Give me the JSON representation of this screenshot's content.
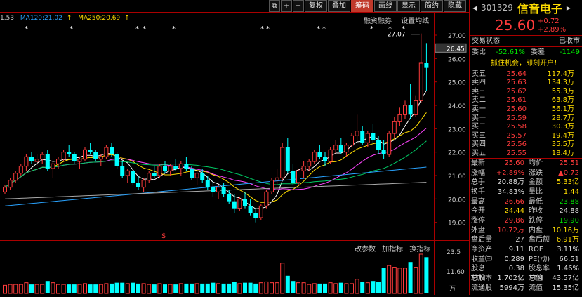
{
  "toolbar": {
    "buttons": [
      "复权",
      "叠加",
      "筹码",
      "画线",
      "显示",
      "简约",
      "隐藏"
    ],
    "active": "筹码"
  },
  "ma_legend": {
    "prefix": "1.53",
    "ma120": "MA120:21.02",
    "ma250": "MA250:20.69"
  },
  "chart_links": {
    "a": "融资融券",
    "b": "设置均线"
  },
  "volume_links": {
    "a": "改参数",
    "b": "加指标",
    "c": "换指标"
  },
  "chart_data": {
    "type": "candlestick",
    "price_axis_labels": [
      "27.00",
      "26.00",
      "25.00",
      "24.00",
      "23.00",
      "22.00",
      "21.00",
      "20.00",
      "19.00"
    ],
    "current_price_tag": "26.45",
    "high_annotation": "27.07",
    "volume_axis_labels": [
      "23.5",
      "11.60"
    ],
    "volume_unit": "万",
    "event_marker": "$",
    "ylim": [
      18.6,
      27.3
    ],
    "candles": [
      [
        20.3,
        20.6,
        20.2,
        20.5
      ],
      [
        20.5,
        20.9,
        20.4,
        20.8
      ],
      [
        20.8,
        21.2,
        20.7,
        21.1
      ],
      [
        21.1,
        21.5,
        21.0,
        21.4
      ],
      [
        21.4,
        21.9,
        21.2,
        21.8
      ],
      [
        21.8,
        22.0,
        21.5,
        21.6
      ],
      [
        21.6,
        21.9,
        21.4,
        21.7
      ],
      [
        21.7,
        22.0,
        21.5,
        21.9
      ],
      [
        21.9,
        22.1,
        21.2,
        21.3
      ],
      [
        21.3,
        21.6,
        20.9,
        21.5
      ],
      [
        21.5,
        21.8,
        21.3,
        21.7
      ],
      [
        21.7,
        22.1,
        21.6,
        22.0
      ],
      [
        22.0,
        22.3,
        21.8,
        21.9
      ],
      [
        21.9,
        22.0,
        21.5,
        21.6
      ],
      [
        21.6,
        21.8,
        21.3,
        21.7
      ],
      [
        21.7,
        22.2,
        21.6,
        22.1
      ],
      [
        22.1,
        22.4,
        21.9,
        22.0
      ],
      [
        22.0,
        22.1,
        21.6,
        21.7
      ],
      [
        21.7,
        21.9,
        21.4,
        21.8
      ],
      [
        21.8,
        22.3,
        21.7,
        22.2
      ],
      [
        22.2,
        22.4,
        21.8,
        21.9
      ],
      [
        21.9,
        22.0,
        21.3,
        21.4
      ],
      [
        21.4,
        21.6,
        20.9,
        21.0
      ],
      [
        21.0,
        21.3,
        20.7,
        21.2
      ],
      [
        21.2,
        21.3,
        20.6,
        20.7
      ],
      [
        20.7,
        21.0,
        20.4,
        20.5
      ],
      [
        20.5,
        20.9,
        20.3,
        20.8
      ],
      [
        20.8,
        21.2,
        20.7,
        21.1
      ],
      [
        21.1,
        21.4,
        20.9,
        21.0
      ],
      [
        21.0,
        21.5,
        20.9,
        21.4
      ],
      [
        21.4,
        21.6,
        21.1,
        21.2
      ],
      [
        21.2,
        21.5,
        21.0,
        21.4
      ],
      [
        21.4,
        21.7,
        21.2,
        21.3
      ],
      [
        21.3,
        21.6,
        21.0,
        21.5
      ],
      [
        21.5,
        21.8,
        21.2,
        21.3
      ],
      [
        21.3,
        21.4,
        20.8,
        20.9
      ],
      [
        20.9,
        21.2,
        20.6,
        21.1
      ],
      [
        21.1,
        21.3,
        20.7,
        20.8
      ],
      [
        20.8,
        21.0,
        20.4,
        20.5
      ],
      [
        20.5,
        20.8,
        20.1,
        20.3
      ],
      [
        20.3,
        20.6,
        20.0,
        20.5
      ],
      [
        20.5,
        20.7,
        20.1,
        20.2
      ],
      [
        20.2,
        20.4,
        19.8,
        19.9
      ],
      [
        19.9,
        20.2,
        19.4,
        19.6
      ],
      [
        19.6,
        20.1,
        19.5,
        20.0
      ],
      [
        20.0,
        20.3,
        19.6,
        19.7
      ],
      [
        19.7,
        20.0,
        19.3,
        19.4
      ],
      [
        19.4,
        19.6,
        19.0,
        19.2
      ],
      [
        19.2,
        19.8,
        19.1,
        19.7
      ],
      [
        19.7,
        20.4,
        19.6,
        20.3
      ],
      [
        20.3,
        20.9,
        20.2,
        20.8
      ],
      [
        20.8,
        21.3,
        20.6,
        20.9
      ],
      [
        20.9,
        22.4,
        20.8,
        22.2
      ],
      [
        22.2,
        22.6,
        21.1,
        21.2
      ],
      [
        21.2,
        21.5,
        20.6,
        20.7
      ],
      [
        20.7,
        21.3,
        20.6,
        21.2
      ],
      [
        21.2,
        21.6,
        20.9,
        21.4
      ],
      [
        21.4,
        21.7,
        21.2,
        21.6
      ],
      [
        21.6,
        22.1,
        21.5,
        22.0
      ],
      [
        22.0,
        22.3,
        21.7,
        21.8
      ],
      [
        21.8,
        22.0,
        21.4,
        21.6
      ],
      [
        21.6,
        22.2,
        21.5,
        22.1
      ],
      [
        22.1,
        22.5,
        21.9,
        22.3
      ],
      [
        22.3,
        22.6,
        21.9,
        22.0
      ],
      [
        22.0,
        22.4,
        21.8,
        22.3
      ],
      [
        22.3,
        22.8,
        22.2,
        22.7
      ],
      [
        22.7,
        23.6,
        22.5,
        22.9
      ],
      [
        22.9,
        23.1,
        22.3,
        22.4
      ],
      [
        22.4,
        22.9,
        22.2,
        22.8
      ],
      [
        22.8,
        23.2,
        22.3,
        22.5
      ],
      [
        22.5,
        22.7,
        21.9,
        22.1
      ],
      [
        22.1,
        22.5,
        21.7,
        21.9
      ],
      [
        21.9,
        22.9,
        21.8,
        22.8
      ],
      [
        22.8,
        23.5,
        22.6,
        23.3
      ],
      [
        23.3,
        23.9,
        23.1,
        23.6
      ],
      [
        23.6,
        24.2,
        23.4,
        24.0
      ],
      [
        24.0,
        24.9,
        23.4,
        23.6
      ],
      [
        23.6,
        24.4,
        23.5,
        24.2
      ],
      [
        24.2,
        27.07,
        24.1,
        25.8
      ],
      [
        25.8,
        26.66,
        24.6,
        25.6
      ]
    ]
  },
  "stock": {
    "code": "301329",
    "name": "信音电子",
    "price": "25.60",
    "change": "+0.72",
    "change_pct": "+2.89%"
  },
  "status": {
    "label": "交易状态",
    "value": "已收市"
  },
  "ratio": {
    "wb_label": "委比",
    "wb": "-52.61%",
    "wc_label": "委差",
    "wc": "-1149"
  },
  "promo": "抓住机会，即刻开户！",
  "order_book": [
    {
      "label": "卖五",
      "price": "25.64",
      "vol": "117.4万"
    },
    {
      "label": "卖四",
      "price": "25.63",
      "vol": "134.3万"
    },
    {
      "label": "卖三",
      "price": "25.62",
      "vol": "55.3万"
    },
    {
      "label": "卖二",
      "price": "25.61",
      "vol": "63.8万"
    },
    {
      "label": "卖一",
      "price": "25.60",
      "vol": "56.1万"
    },
    {
      "label": "买一",
      "price": "25.59",
      "vol": "28.7万"
    },
    {
      "label": "买二",
      "price": "25.58",
      "vol": "30.3万"
    },
    {
      "label": "买三",
      "price": "25.57",
      "vol": "19.4万"
    },
    {
      "label": "买四",
      "price": "25.56",
      "vol": "35.5万"
    },
    {
      "label": "买五",
      "price": "25.55",
      "vol": "18.4万"
    }
  ],
  "quotes": [
    {
      "l1": "最新",
      "v1": "25.60",
      "c1": "red",
      "l2": "均价",
      "v2": "25.51",
      "c2": "red"
    },
    {
      "l1": "涨幅",
      "v1": "+2.89%",
      "c1": "red",
      "l2": "涨跌",
      "v2": "▲0.72",
      "c2": "red"
    },
    {
      "l1": "总手",
      "v1": "20.88万",
      "c1": "white",
      "l2": "金额",
      "v2": "5.33亿",
      "c2": "yellow"
    },
    {
      "l1": "换手",
      "v1": "34.83%",
      "c1": "white",
      "l2": "量比",
      "v2": "1.44",
      "c2": "yellow"
    },
    {
      "l1": "最高",
      "v1": "26.66",
      "c1": "red",
      "l2": "最低",
      "v2": "23.88",
      "c2": "green"
    },
    {
      "l1": "今开",
      "v1": "24.44",
      "c1": "yellow",
      "l2": "昨收",
      "v2": "24.88",
      "c2": "white"
    },
    {
      "l1": "涨停",
      "v1": "29.86",
      "c1": "red",
      "l2": "跌停",
      "v2": "19.90",
      "c2": "green"
    },
    {
      "l1": "外盘",
      "v1": "10.72万",
      "c1": "red",
      "l2": "内盘",
      "v2": "10.16万",
      "c2": "yellow"
    },
    {
      "l1": "盘后量",
      "v1": "27",
      "c1": "white",
      "l2": "盘后额",
      "v2": "6.91万",
      "c2": "yellow"
    },
    {
      "l1": "净资产",
      "v1": "9.11",
      "c1": "white",
      "l2": "ROE",
      "v2": "3.11%",
      "c2": "white"
    },
    {
      "l1": "收益㈢",
      "v1": "0.289",
      "c1": "white",
      "l2": "PE(动)",
      "v2": "66.51",
      "c2": "white"
    },
    {
      "l1": "股息TTM",
      "v1": "0.38",
      "c1": "white",
      "l2": "股息率TTM",
      "v2": "1.46%",
      "c2": "white"
    },
    {
      "l1": "总股本",
      "v1": "1.702亿",
      "c1": "white",
      "l2": "总值",
      "v2": "43.57亿",
      "c2": "white"
    },
    {
      "l1": "流通股",
      "v1": "5994万",
      "c1": "white",
      "l2": "流值",
      "v2": "15.35亿",
      "c2": "white"
    }
  ]
}
